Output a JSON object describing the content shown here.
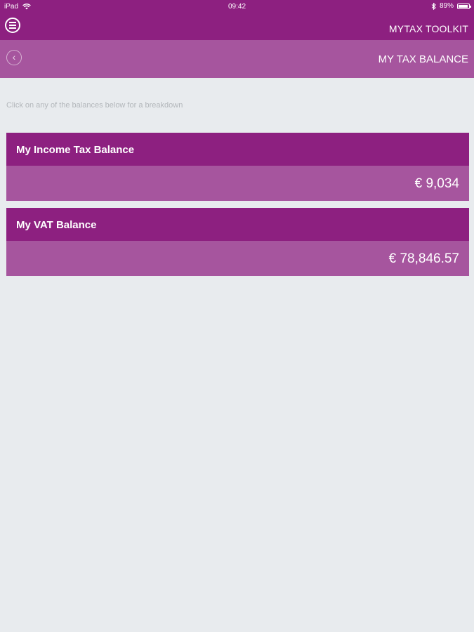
{
  "status_bar": {
    "device": "iPad",
    "time": "09:42",
    "battery_percent": "89%",
    "battery_level": 0.89
  },
  "header": {
    "app_title": "MYTAX TOOLKIT"
  },
  "subheader": {
    "title": "MY TAX BALANCE"
  },
  "hint": "Click on any of the balances below for a breakdown",
  "balances": [
    {
      "label": "My Income Tax Balance",
      "amount": "€ 9,034"
    },
    {
      "label": "My VAT Balance",
      "amount": "€ 78,846.57"
    }
  ],
  "colors": {
    "primary": "#8d2080",
    "secondary": "#a6559e",
    "background": "#e8ebee"
  },
  "icons": [
    "wifi-icon",
    "bluetooth-icon",
    "battery-icon",
    "menu-icon",
    "back-icon"
  ]
}
